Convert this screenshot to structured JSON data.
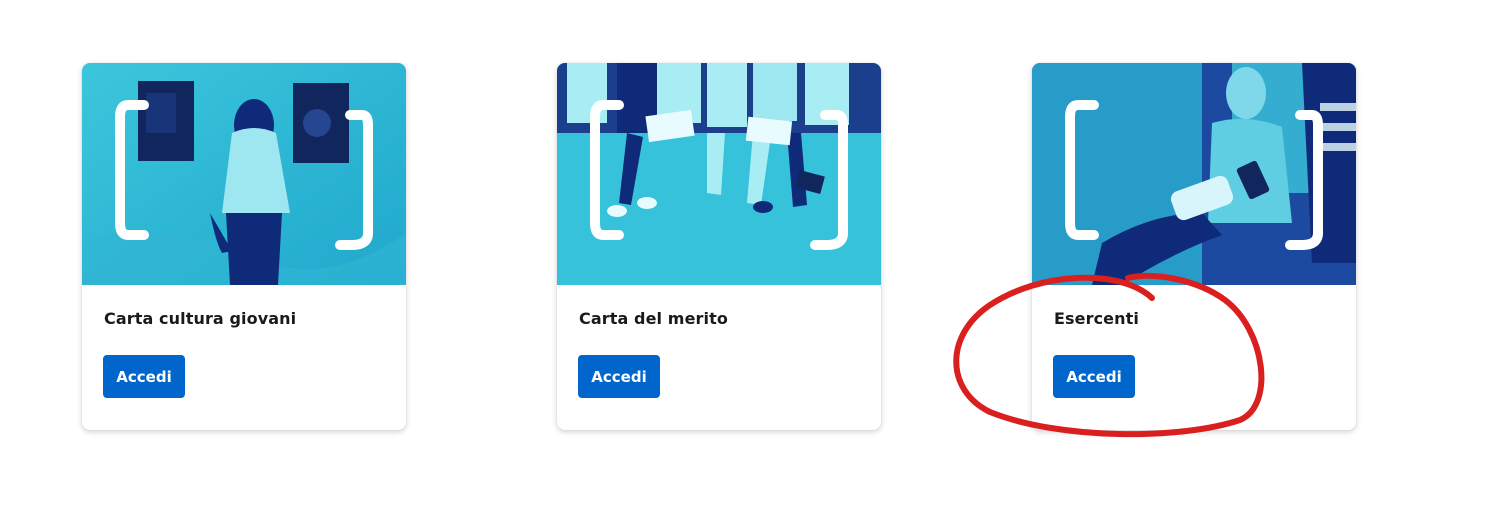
{
  "cards": [
    {
      "title": "Carta cultura giovani",
      "button_label": "Accedi",
      "image_subject": "person viewing artwork in gallery"
    },
    {
      "title": "Carta del merito",
      "button_label": "Accedi",
      "image_subject": "students sitting with books and laptops"
    },
    {
      "title": "Esercenti",
      "button_label": "Accedi",
      "image_subject": "merchant card payment terminal"
    }
  ],
  "colors": {
    "accent": "#0066cc",
    "image_tint": "#2ec4dc",
    "image_dark": "#0f2a78",
    "annotation": "#d9201f"
  }
}
